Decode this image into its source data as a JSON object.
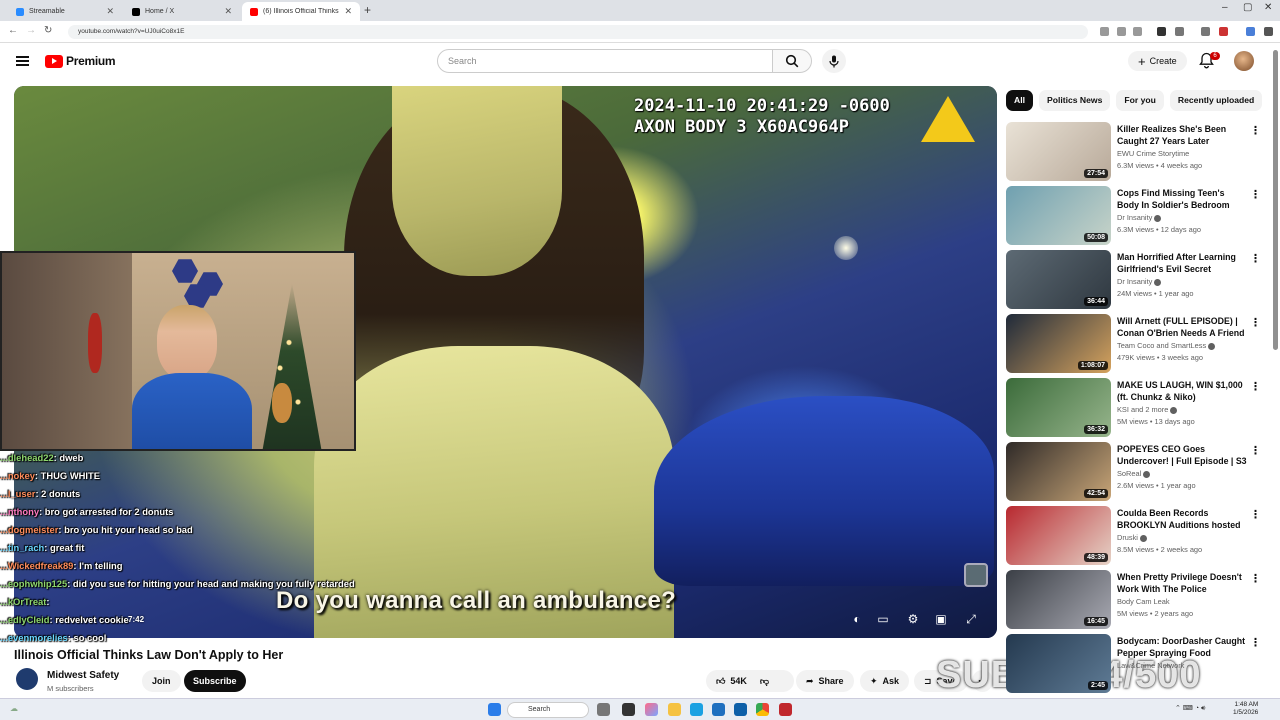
{
  "browser": {
    "tabs": [
      {
        "label": "Streamable",
        "active": false
      },
      {
        "label": "Home / X",
        "active": false
      },
      {
        "label": "(6) Illinois Official Thinks La...",
        "active": true
      }
    ],
    "url": "youtube.com/watch?v=UJ0uiCo8x1E"
  },
  "masthead": {
    "brand": "Premium",
    "search_placeholder": "Search",
    "create_label": "Create",
    "notif_count": "6"
  },
  "player": {
    "cam_line1": "2024-11-10 20:41:29 -0600",
    "cam_line2": "AXON BODY 3 X60AC964P",
    "subtitle": "Do you wanna call an ambulance?",
    "time_display": "7:42",
    "progress": 0.63
  },
  "chat": [
    {
      "user": "...dlehead22",
      "msg": ": dweb",
      "color": "green"
    },
    {
      "user": "...nokey",
      "msg": ": THUG WHITE",
      "color": "orange"
    },
    {
      "user": "...l_user",
      "msg": ": 2 donuts",
      "color": "orange"
    },
    {
      "user": "...nthony",
      "msg": ": bro got arrested for 2 donuts",
      "color": "pink"
    },
    {
      "user": "...dogmeister",
      "msg": ": bro you hit your head so bad",
      "color": "orange"
    },
    {
      "user": "...tin_rach",
      "msg": ": great fit",
      "color": "cyan"
    },
    {
      "user": "...Wickedfreak89",
      "msg": ": I'm telling",
      "color": "orange"
    },
    {
      "user": "...eophwhip125",
      "msg": ": did you sue for hitting your head and making you fully retarded",
      "color": "green"
    },
    {
      "user": "...kOrTreat",
      "msg": ":",
      "color": "green"
    },
    {
      "user": "...edlyCleid",
      "msg": ": redvelvet cookie",
      "color": "green"
    },
    {
      "user": "...evenmorelies",
      "msg": ": so cool",
      "color": "cyan"
    }
  ],
  "video": {
    "title": "Illinois Official Thinks Law Don't Apply to Her",
    "channel": "Midwest Safety",
    "subscribers": "M subscribers",
    "join_label": "Join",
    "subscribe_label": "Subscribe",
    "likes": "54K",
    "share_label": "Share",
    "ask_label": "Ask",
    "save_label": "Save",
    "overlay_text": "SUBS 214/500"
  },
  "sidebar": {
    "chips": [
      "All",
      "Politics News",
      "For you",
      "Recently uploaded"
    ],
    "recommendations": [
      {
        "title": "Killer Realizes She's Been Caught 27 Years Later",
        "channel": "EWU Crime Storytime",
        "meta": "6.3M views • 4 weeks ago",
        "duration": "27:54",
        "verified": false
      },
      {
        "title": "Cops Find Missing Teen's Body In Soldier's Bedroom",
        "channel": "Dr Insanity",
        "meta": "6.3M views • 12 days ago",
        "duration": "50:08",
        "verified": true
      },
      {
        "title": "Man Horrified After Learning Girlfriend's Evil Secret",
        "channel": "Dr Insanity",
        "meta": "24M views • 1 year ago",
        "duration": "36:44",
        "verified": true
      },
      {
        "title": "Will Arnett (FULL EPISODE) | Conan O'Brien Needs A Friend",
        "channel": "Team Coco and SmartLess",
        "meta": "479K views • 3 weeks ago",
        "duration": "1:08:07",
        "verified": true
      },
      {
        "title": "MAKE US LAUGH, WIN $1,000 (ft. Chunkz & Niko)",
        "channel": "KSI and 2 more",
        "meta": "5M views • 13 days ago",
        "duration": "36:32",
        "verified": true
      },
      {
        "title": "POPEYES CEO Goes Undercover! | Full Episode | S3 ...",
        "channel": "SoReal",
        "meta": "2.6M views • 1 year ago",
        "duration": "42:54",
        "verified": true
      },
      {
        "title": "Coulda Been Records BROOKLYN Auditions hosted b...",
        "channel": "Druski",
        "meta": "8.5M views • 2 weeks ago",
        "duration": "48:39",
        "verified": true
      },
      {
        "title": "When Pretty Privilege Doesn't Work With The Police",
        "channel": "Body Cam Leak",
        "meta": "5M views • 2 years ago",
        "duration": "16:45",
        "verified": false
      },
      {
        "title": "Bodycam: DoorDasher Caught Pepper Spraying Food Delivery",
        "channel": "Law&Crime Network",
        "meta": "",
        "duration": "2:45",
        "verified": false
      }
    ]
  },
  "taskbar": {
    "search_label": "Search",
    "time": "1:48 AM",
    "date": "1/5/2026"
  },
  "colors": {
    "yt_red": "#ff0000",
    "chip_active": "#0f0f0f"
  }
}
